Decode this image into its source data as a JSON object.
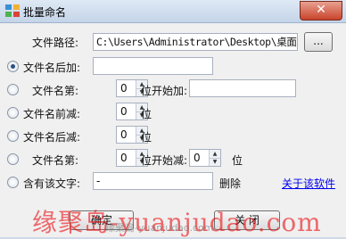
{
  "window": {
    "title": "批量命名",
    "close_glyph": "✕"
  },
  "path": {
    "label": "文件路径:",
    "value": "C:\\Users\\Administrator\\Desktop\\桌面集合",
    "browse_label": "..."
  },
  "options": [
    {
      "label": "文件名后加:",
      "checked": true,
      "text_value": ""
    },
    {
      "label": "文件名第:",
      "checked": false,
      "spin_value": "0",
      "suffix": "位开始加:",
      "text_value": ""
    },
    {
      "label": "文件名前减:",
      "checked": false,
      "spin_value": "0",
      "suffix": "位"
    },
    {
      "label": "文件名后减:",
      "checked": false,
      "spin_value": "0",
      "suffix": "位"
    },
    {
      "label": "文件名第:",
      "checked": false,
      "spin_value": "0",
      "suffix": "位开始减:",
      "spin2_value": "0",
      "suffix2": "位"
    },
    {
      "label": "含有该文字:",
      "checked": false,
      "text_value": "-",
      "suffix": "删除"
    }
  ],
  "about_link": "关于该软件",
  "buttons": {
    "ok": "确定",
    "close": "关 闭"
  },
  "watermark": {
    "text": "缘聚岛-yuanjudao.com",
    "small": "缘聚岛-yuanjudao.com"
  },
  "colors": {
    "link": "#0000ee",
    "watermark": "#eb1419",
    "titlebar": "#c4d4e8"
  }
}
